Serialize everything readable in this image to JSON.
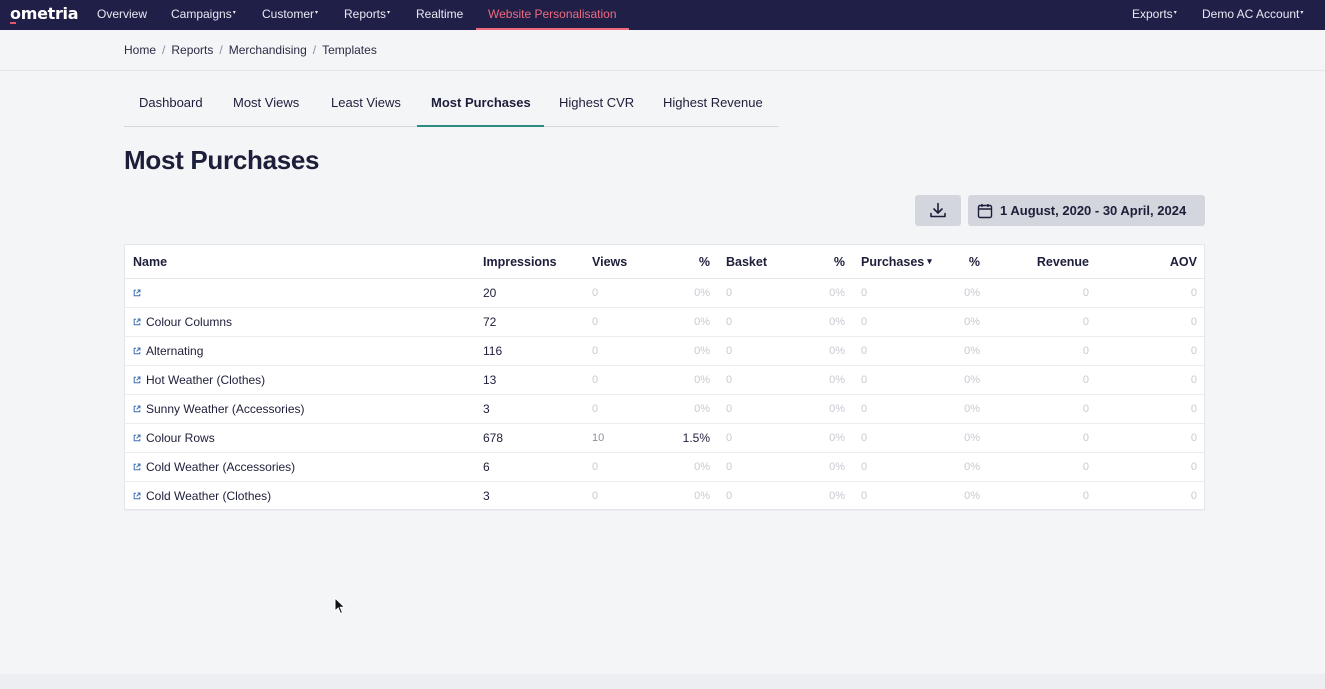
{
  "nav": {
    "logo": "ometria",
    "items": [
      {
        "label": "Overview",
        "caret": ""
      },
      {
        "label": "Campaigns",
        "caret": "▾"
      },
      {
        "label": "Customer",
        "caret": "▾"
      },
      {
        "label": "Reports",
        "caret": "▾"
      },
      {
        "label": "Realtime",
        "caret": ""
      },
      {
        "label": "Website Personalisation",
        "caret": ""
      }
    ],
    "right": [
      {
        "label": "Exports",
        "caret": "▾"
      },
      {
        "label": "Demo AC Account",
        "caret": "▾"
      }
    ],
    "active_color": "#f06a7e",
    "bg_color": "#1f1f48"
  },
  "breadcrumb": [
    "Home",
    "Reports",
    "Merchandising",
    "Templates"
  ],
  "tabs": [
    "Dashboard",
    "Most Views",
    "Least Views",
    "Most Purchases",
    "Highest CVR",
    "Highest Revenue"
  ],
  "active_tab": "Most Purchases",
  "page_title": "Most Purchases",
  "date_range": "1 August, 2020 - 30 April, 2024",
  "icons": {
    "download": "download-icon",
    "calendar": "calendar-icon",
    "external": "external-link-icon"
  },
  "table": {
    "columns": [
      "Name",
      "Impressions",
      "Views",
      "%",
      "Basket",
      "%",
      "Purchases",
      "%",
      "Revenue",
      "AOV"
    ],
    "sorted_column": "Purchases",
    "sort_indicator": "▾",
    "rows": [
      {
        "name": "",
        "impressions": "20",
        "views": "0",
        "views_pct": "0%",
        "basket": "0",
        "basket_pct": "0%",
        "purchases": "0",
        "purchases_pct": "0%",
        "revenue": "0",
        "aov": "0"
      },
      {
        "name": "Colour Columns",
        "impressions": "72",
        "views": "0",
        "views_pct": "0%",
        "basket": "0",
        "basket_pct": "0%",
        "purchases": "0",
        "purchases_pct": "0%",
        "revenue": "0",
        "aov": "0"
      },
      {
        "name": "Alternating",
        "impressions": "116",
        "views": "0",
        "views_pct": "0%",
        "basket": "0",
        "basket_pct": "0%",
        "purchases": "0",
        "purchases_pct": "0%",
        "revenue": "0",
        "aov": "0"
      },
      {
        "name": "Hot Weather (Clothes)",
        "impressions": "13",
        "views": "0",
        "views_pct": "0%",
        "basket": "0",
        "basket_pct": "0%",
        "purchases": "0",
        "purchases_pct": "0%",
        "revenue": "0",
        "aov": "0"
      },
      {
        "name": "Sunny Weather (Accessories)",
        "impressions": "3",
        "views": "0",
        "views_pct": "0%",
        "basket": "0",
        "basket_pct": "0%",
        "purchases": "0",
        "purchases_pct": "0%",
        "revenue": "0",
        "aov": "0"
      },
      {
        "name": "Colour Rows",
        "impressions": "678",
        "views": "10",
        "views_pct": "1.5%",
        "basket": "0",
        "basket_pct": "0%",
        "purchases": "0",
        "purchases_pct": "0%",
        "revenue": "0",
        "aov": "0"
      },
      {
        "name": "Cold Weather (Accessories)",
        "impressions": "6",
        "views": "0",
        "views_pct": "0%",
        "basket": "0",
        "basket_pct": "0%",
        "purchases": "0",
        "purchases_pct": "0%",
        "revenue": "0",
        "aov": "0"
      },
      {
        "name": "Cold Weather (Clothes)",
        "impressions": "3",
        "views": "0",
        "views_pct": "0%",
        "basket": "0",
        "basket_pct": "0%",
        "purchases": "0",
        "purchases_pct": "0%",
        "revenue": "0",
        "aov": "0"
      }
    ]
  }
}
